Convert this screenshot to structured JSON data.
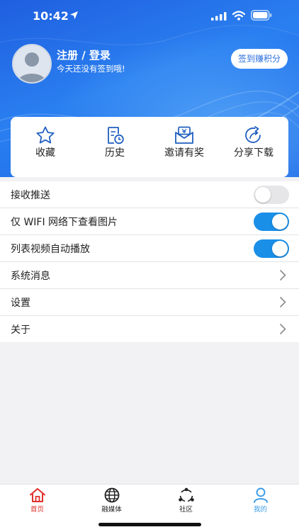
{
  "status_bar": {
    "time": "10:42"
  },
  "profile": {
    "title": "注册 / 登录",
    "subtitle": "今天还没有签到哦!",
    "sign_button": "签到赚积分"
  },
  "quick_actions": [
    {
      "label": "收藏",
      "icon": "star-icon"
    },
    {
      "label": "历史",
      "icon": "history-icon"
    },
    {
      "label": "邀请有奖",
      "icon": "invite-icon"
    },
    {
      "label": "分享下载",
      "icon": "share-icon"
    }
  ],
  "settings": [
    {
      "label": "接收推送",
      "control": "toggle",
      "on": false
    },
    {
      "label": "仅 WIFI 网络下查看图片",
      "control": "toggle",
      "on": true
    },
    {
      "label": "列表视频自动播放",
      "control": "toggle",
      "on": true
    },
    {
      "label": "系统消息",
      "control": "chevron"
    },
    {
      "label": "设置",
      "control": "chevron"
    },
    {
      "label": "关于",
      "control": "chevron"
    }
  ],
  "tabs": [
    {
      "label": "首页",
      "icon": "home-icon",
      "color": "#e0302a"
    },
    {
      "label": "融媒体",
      "icon": "globe-icon",
      "color": "#222222"
    },
    {
      "label": "社区",
      "icon": "community-icon",
      "color": "#222222"
    },
    {
      "label": "我的",
      "icon": "person-icon",
      "color": "#3a9be8"
    }
  ],
  "colors": {
    "header_blue": "#1f5fe0",
    "toggle_on": "#1a8fe8",
    "home_active": "#e0302a",
    "mine_active": "#3a9be8"
  }
}
